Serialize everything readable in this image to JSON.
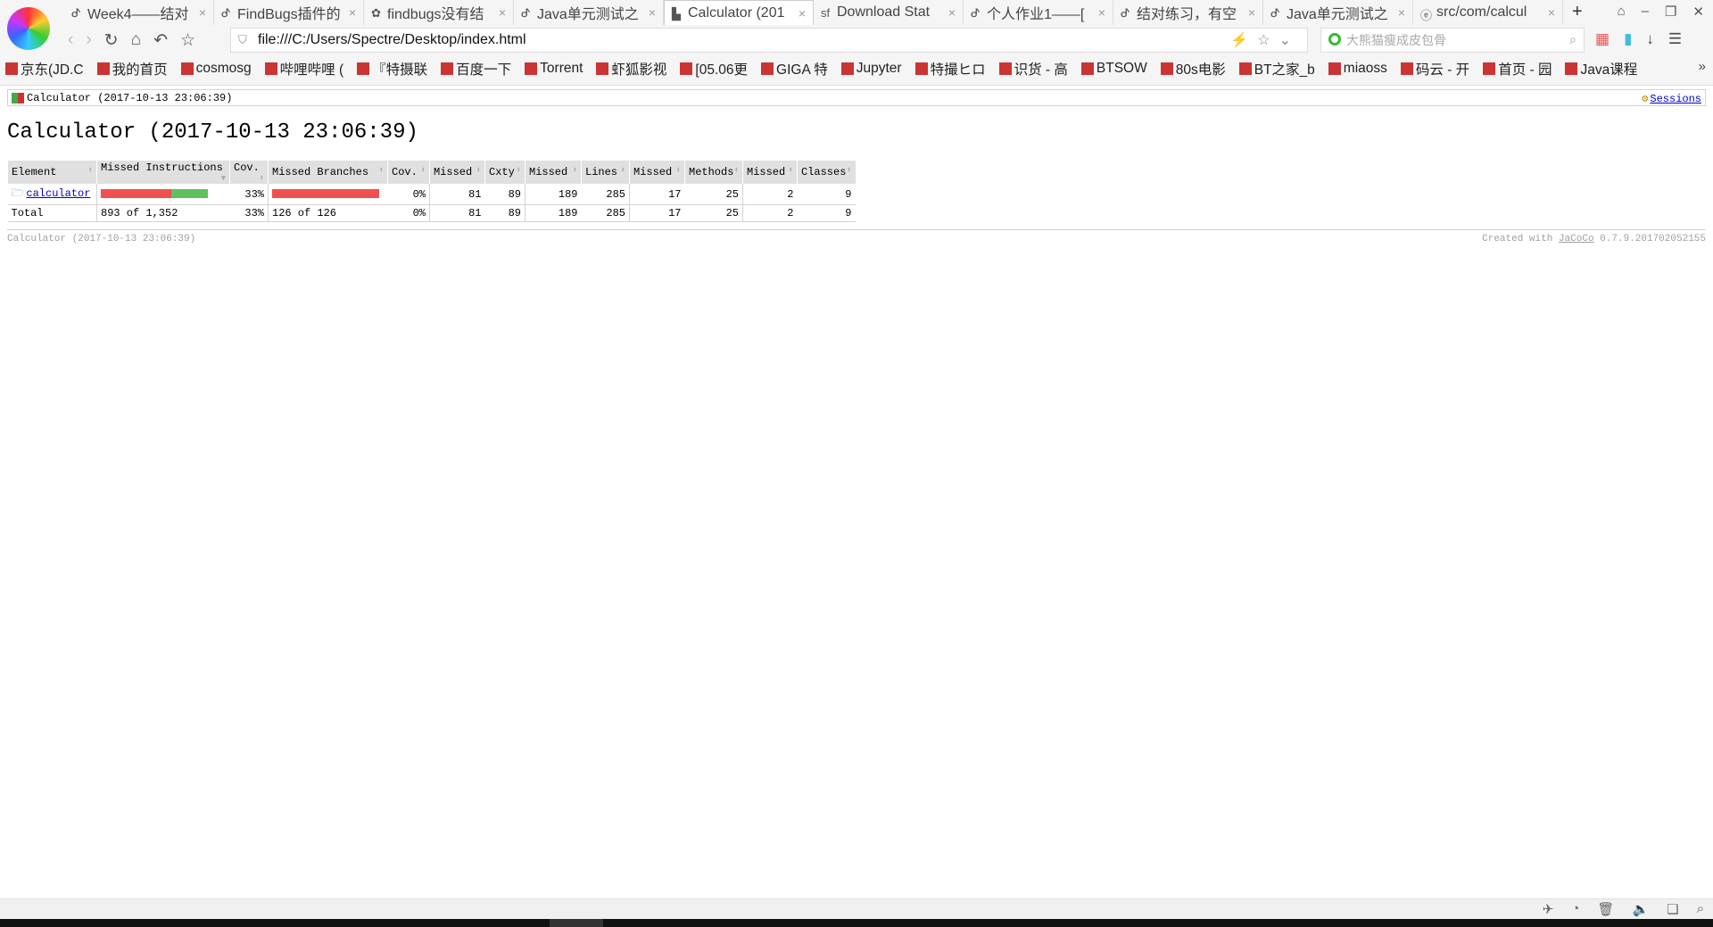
{
  "browser": {
    "tabs": [
      {
        "label": "Week4——结对",
        "icon": "csdn-icon"
      },
      {
        "label": "FindBugs插件的",
        "icon": "csdn-icon"
      },
      {
        "label": "findbugs没有结",
        "icon": "baidu-icon"
      },
      {
        "label": "Java单元测试之",
        "icon": "csdn-icon"
      },
      {
        "label": "Calculator (201",
        "icon": "jacoco-icon",
        "active": true
      },
      {
        "label": "Download Stat",
        "icon": "sf-icon"
      },
      {
        "label": "个人作业1——[",
        "icon": "csdn-icon"
      },
      {
        "label": "结对练习，有空",
        "icon": "csdn-icon"
      },
      {
        "label": "Java单元测试之",
        "icon": "csdn-icon"
      },
      {
        "label": "src/com/calcul",
        "icon": "gitee-icon"
      }
    ],
    "new_tab": "+",
    "url": "file:///C:/Users/Spectre/Desktop/index.html",
    "search_placeholder": "大熊猫瘦成皮包骨",
    "bookmarks": [
      "京东(JD.C",
      "我的首页",
      "cosmosg",
      "哔哩哔哩 (",
      "『特摄联",
      "百度一下",
      "Torrent",
      "虾狐影视",
      "[05.06更",
      "GIGA 特",
      "Jupyter",
      "特撮ヒロ",
      "识货 - 高",
      "BTSOW",
      "80s电影",
      "BT之家_b",
      "miaoss",
      "码云 - 开",
      "首页 - 园",
      "Java课程"
    ],
    "bookmarks_more": "»"
  },
  "report": {
    "breadcrumb": "Calculator (2017-10-13 23:06:39)",
    "sessions_link": "Sessions",
    "title": "Calculator (2017-10-13 23:06:39)",
    "columns": [
      "Element",
      "Missed Instructions",
      "Cov.",
      "Missed Branches",
      "Cov.",
      "Missed",
      "Cxty",
      "Missed",
      "Lines",
      "Missed",
      "Methods",
      "Missed",
      "Classes"
    ],
    "rows": [
      {
        "element": "calculator",
        "instr_missed_fraction": 0.66,
        "instr_cov": "33%",
        "branch_missed_fraction": 1.0,
        "branch_cov": "0%",
        "missed_cxty": "81",
        "cxty": "89",
        "missed_lines": "189",
        "lines": "285",
        "missed_methods": "17",
        "methods": "25",
        "missed_classes": "2",
        "classes": "9"
      }
    ],
    "total": {
      "label": "Total",
      "instr": "893 of 1,352",
      "instr_cov": "33%",
      "branches": "126 of 126",
      "branch_cov": "0%",
      "missed_cxty": "81",
      "cxty": "89",
      "missed_lines": "189",
      "lines": "285",
      "missed_methods": "17",
      "methods": "25",
      "missed_classes": "2",
      "classes": "9"
    },
    "footer_left": "Calculator (2017-10-13 23:06:39)",
    "footer_created": "Created with",
    "footer_link": "JaCoCo",
    "footer_version": "0.7.9.201702052155",
    "colors": {
      "missed": "#f05050",
      "covered": "#60c060",
      "link": "#0000cc"
    }
  }
}
